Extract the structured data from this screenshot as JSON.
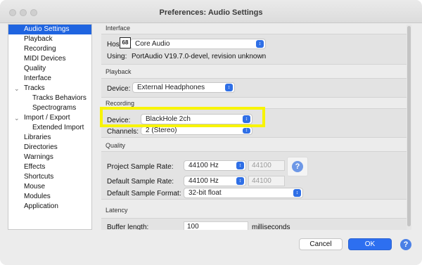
{
  "window": {
    "title": "Preferences: Audio Settings"
  },
  "sidebar": {
    "items": [
      {
        "label": "Audio Settings",
        "selected": true
      },
      {
        "label": "Playback"
      },
      {
        "label": "Recording"
      },
      {
        "label": "MIDI Devices"
      },
      {
        "label": "Quality"
      },
      {
        "label": "Interface"
      },
      {
        "label": "Tracks",
        "expandable": true
      },
      {
        "label": "Tracks Behaviors",
        "child": true
      },
      {
        "label": "Spectrograms",
        "child": true
      },
      {
        "label": "Import / Export",
        "expandable": true
      },
      {
        "label": "Extended Import",
        "child": true
      },
      {
        "label": "Libraries"
      },
      {
        "label": "Directories"
      },
      {
        "label": "Warnings"
      },
      {
        "label": "Effects"
      },
      {
        "label": "Shortcuts"
      },
      {
        "label": "Mouse"
      },
      {
        "label": "Modules"
      },
      {
        "label": "Application"
      }
    ]
  },
  "interface": {
    "section_title": "Interface",
    "host_label": "Hos",
    "host_value": "Core Audio",
    "using_label": "Using:",
    "using_value": "PortAudio V19.7.0-devel, revision unknown",
    "badge": "68"
  },
  "playback": {
    "section_title": "Playback",
    "device_label": "Device:",
    "device_value": "External Headphones"
  },
  "recording": {
    "section_title": "Recording",
    "device_label": "Device:",
    "device_value": "BlackHole 2ch",
    "channels_label": "Channels:",
    "channels_value": "2 (Stereo)"
  },
  "quality": {
    "section_title": "Quality",
    "project_rate_label": "Project Sample Rate:",
    "project_rate_value": "44100 Hz",
    "project_rate_field": "44100",
    "default_rate_label": "Default Sample Rate:",
    "default_rate_value": "44100 Hz",
    "default_rate_field": "44100",
    "default_format_label": "Default Sample Format:",
    "default_format_value": "32-bit float",
    "help_glyph": "?"
  },
  "latency": {
    "section_title": "Latency",
    "buffer_label": "Buffer length:",
    "buffer_value": "100",
    "buffer_unit": "milliseconds"
  },
  "footer": {
    "cancel_label": "Cancel",
    "ok_label": "OK",
    "help_glyph": "?"
  },
  "colors": {
    "accent": "#2d6ff0",
    "sidebar_selected": "#1f64e0",
    "highlight": "#f8f400"
  }
}
